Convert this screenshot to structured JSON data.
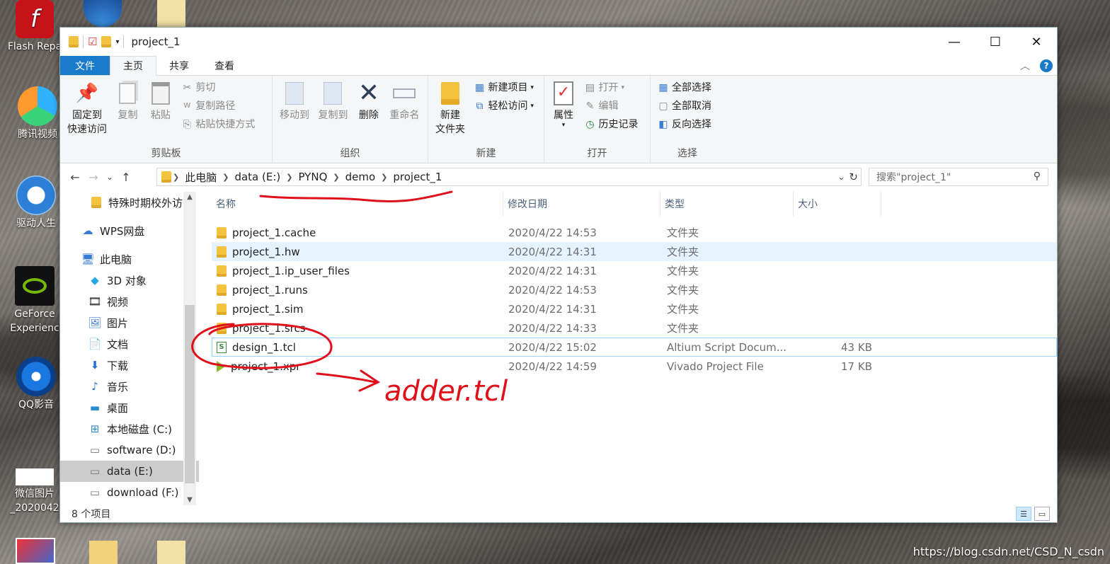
{
  "desktop": {
    "icons": [
      {
        "label": "Flash Repa"
      },
      {
        "label": "腾讯视频"
      },
      {
        "label": "驱动人生"
      },
      {
        "label": "GeForce",
        "label2": "Experienc"
      },
      {
        "label": "QQ影音"
      },
      {
        "label": "微信图片",
        "label2": "_2020042"
      }
    ],
    "watermark": "https://blog.csdn.net/CSD_N_csdn"
  },
  "window": {
    "title": "project_1",
    "caption": {
      "minimize": "—",
      "maximize": "☐",
      "close": "✕"
    }
  },
  "tabs": {
    "file": "文件",
    "home": "主页",
    "share": "共享",
    "view": "查看"
  },
  "ribbon": {
    "clipboard": {
      "label": "剪贴板",
      "pin": "固定到",
      "pin2": "快速访问",
      "copy": "复制",
      "paste": "粘贴",
      "cut": "剪切",
      "copy_path": "复制路径",
      "paste_shortcut": "粘贴快捷方式"
    },
    "organize": {
      "label": "组织",
      "move_to": "移动到",
      "copy_to": "复制到",
      "delete": "删除",
      "rename": "重命名"
    },
    "new": {
      "label": "新建",
      "new_folder": "新建",
      "new_folder2": "文件夹",
      "new_item": "新建项目",
      "easy_access": "轻松访问"
    },
    "open": {
      "label": "打开",
      "properties": "属性",
      "open": "打开",
      "edit": "编辑",
      "history": "历史记录"
    },
    "select": {
      "label": "选择",
      "select_all": "全部选择",
      "select_none": "全部取消",
      "invert": "反向选择"
    }
  },
  "nav": {
    "back": "←",
    "forward": "→",
    "recent": "⌄",
    "up": "↑",
    "breadcrumb": [
      "此电脑",
      "data (E:)",
      "PYNQ",
      "demo",
      "project_1"
    ],
    "search_placeholder": "搜索\"project_1\""
  },
  "sidebar": [
    {
      "label": "特殊时期校外访问"
    },
    {
      "label": "WPS网盘"
    },
    {
      "label": "此电脑"
    },
    {
      "label": "3D 对象"
    },
    {
      "label": "视频"
    },
    {
      "label": "图片"
    },
    {
      "label": "文档"
    },
    {
      "label": "下载"
    },
    {
      "label": "音乐"
    },
    {
      "label": "桌面"
    },
    {
      "label": "本地磁盘 (C:)"
    },
    {
      "label": "software (D:)"
    },
    {
      "label": "data (E:)"
    },
    {
      "label": "download (F:)"
    }
  ],
  "columns": {
    "name": "名称",
    "modified": "修改日期",
    "type": "类型",
    "size": "大小"
  },
  "files": [
    {
      "name": "project_1.cache",
      "modified": "2020/4/22 14:53",
      "type": "文件夹",
      "size": ""
    },
    {
      "name": "project_1.hw",
      "modified": "2020/4/22 14:31",
      "type": "文件夹",
      "size": ""
    },
    {
      "name": "project_1.ip_user_files",
      "modified": "2020/4/22 14:31",
      "type": "文件夹",
      "size": ""
    },
    {
      "name": "project_1.runs",
      "modified": "2020/4/22 14:53",
      "type": "文件夹",
      "size": ""
    },
    {
      "name": "project_1.sim",
      "modified": "2020/4/22 14:31",
      "type": "文件夹",
      "size": ""
    },
    {
      "name": "project_1.srcs",
      "modified": "2020/4/22 14:33",
      "type": "文件夹",
      "size": ""
    },
    {
      "name": "design_1.tcl",
      "modified": "2020/4/22 15:02",
      "type": "Altium Script Docum...",
      "size": "43 KB"
    },
    {
      "name": "project_1.xpr",
      "modified": "2020/4/22 14:59",
      "type": "Vivado Project File",
      "size": "17 KB"
    }
  ],
  "status": {
    "count": "8 个项目"
  },
  "annotation": {
    "text": "adder.tcl",
    "color": "#e0101a"
  }
}
